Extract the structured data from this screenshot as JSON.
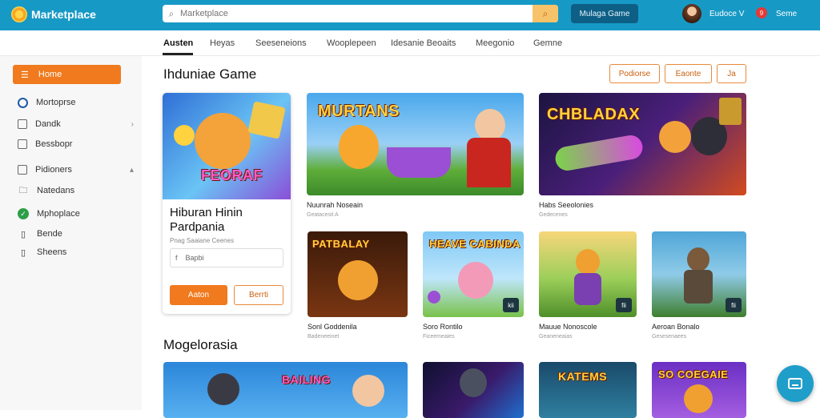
{
  "app": {
    "title": "Marketplace"
  },
  "colors": {
    "topbar": "#1799c6",
    "accent": "#f07a1d",
    "sidebar": "#f7f7f7"
  },
  "header": {
    "search_placeholder": "Marketplace",
    "cta_label": "Mulaga Game",
    "user_name": "Eudoce V",
    "notifications": "9",
    "link_label": "Seme"
  },
  "nav": {
    "items": [
      "Austen",
      "Heyas",
      "Seeseneions",
      "Wooplepeen",
      "Idesanie Beoaits",
      "Meegonio",
      "Gemne"
    ]
  },
  "sidebar": {
    "primary_label": "Home",
    "items": [
      {
        "label": "Mortoprse",
        "icon": "clock-icon"
      },
      {
        "label": "Dandk",
        "icon": "square-icon",
        "chevron": "›"
      },
      {
        "label": "Bessbopr",
        "icon": "square-icon"
      },
      {
        "label": "Pidioners",
        "icon": "square-icon",
        "chevron": "▴"
      },
      {
        "label": "Natedans",
        "icon": "folder-icon"
      },
      {
        "label": "Mphoplace",
        "icon": "check-circle-icon"
      },
      {
        "label": "Bende",
        "icon": "doc-icon"
      },
      {
        "label": "Sheens",
        "icon": "doc-icon"
      }
    ]
  },
  "main": {
    "section1_title": "Ihduniae Game",
    "actions": [
      "Podiorse",
      "Eaonte",
      "Ja"
    ],
    "featured": {
      "title": "Hiburan Hinin Pardpania",
      "subtitle": "Pnag Saaiane Ceenes",
      "input_value": "Bapbi",
      "primary_label": "Aaton",
      "secondary_label": "Berrti",
      "art_text": "FEORAF"
    },
    "games_row1": [
      {
        "title": "Nuunrah Noseain",
        "meta": "Geatacesit A",
        "art_text": "MURTANS"
      },
      {
        "title": "Habs Seeolonies",
        "meta": "Gedecenes",
        "art_text": "CHBLADAX"
      }
    ],
    "games_row2": [
      {
        "title": "Sonl Goddenila",
        "meta": "Badeneeinet",
        "art_text": "PATBALAY",
        "badge": ""
      },
      {
        "title": "Soro Rontilo",
        "meta": "Ficeemeaies",
        "art_text": "HEAVE CABINDA",
        "badge": "kii"
      },
      {
        "title": "Mauue Nonoscole",
        "meta": "Geaneneaias",
        "art_text": "",
        "badge": "fii"
      },
      {
        "title": "Aeroan Bonalo",
        "meta": "Gesesenaees",
        "art_text": "",
        "badge": "fii"
      }
    ],
    "section2_title": "Mogelorasia",
    "games_row3": [
      {
        "art_text": "BAILING"
      },
      {
        "art_text": ""
      },
      {
        "art_text": "KATEMS"
      },
      {
        "art_text": "SO COEGAIE"
      }
    ]
  }
}
